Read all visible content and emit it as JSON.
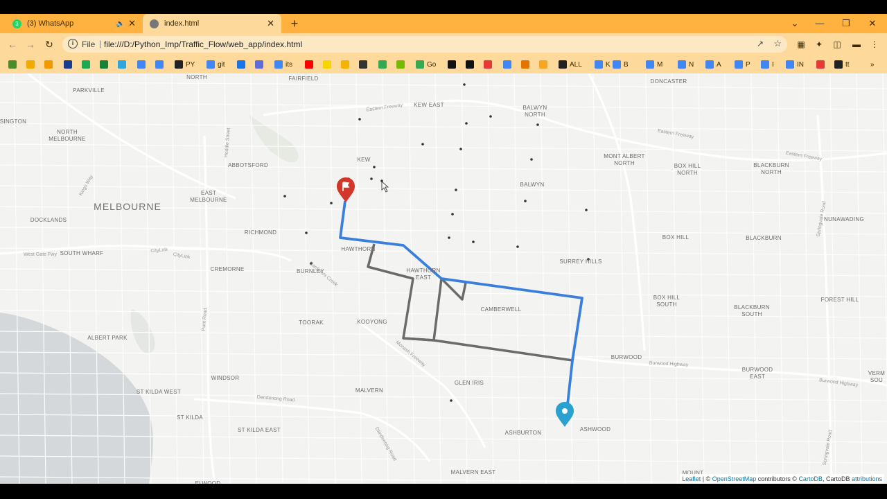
{
  "tabs": [
    {
      "title": "(3) WhatsApp",
      "badge": "3",
      "active": false
    },
    {
      "title": "index.html",
      "active": true
    }
  ],
  "omnibox": {
    "scheme": "File",
    "url": "file:///D:/Python_Imp/Traffic_Flow/web_app/index.html"
  },
  "bookmarks": [
    {
      "label": "",
      "color": "#4b8b2b"
    },
    {
      "label": "",
      "color": "#f2a900"
    },
    {
      "label": "",
      "color": "#f29900"
    },
    {
      "label": "",
      "color": "#1a3e8c"
    },
    {
      "label": "",
      "color": "#1da851"
    },
    {
      "label": "",
      "color": "#188038"
    },
    {
      "label": "",
      "color": "#2ca5e0"
    },
    {
      "label": "",
      "color": "#4285f4"
    },
    {
      "label": "",
      "color": "#4285f4"
    },
    {
      "label": "PY",
      "color": "#222222"
    },
    {
      "label": "git",
      "color": "#4285f4"
    },
    {
      "label": "",
      "color": "#1a73e8"
    },
    {
      "label": "",
      "color": "#5f6bd6"
    },
    {
      "label": "its",
      "color": "#4285f4"
    },
    {
      "label": "",
      "color": "#ff0000"
    },
    {
      "label": "",
      "color": "#f7d600"
    },
    {
      "label": "",
      "color": "#f5b301"
    },
    {
      "label": "",
      "color": "#333333"
    },
    {
      "label": "",
      "color": "#34a853"
    },
    {
      "label": "",
      "color": "#76b900"
    },
    {
      "label": "Go",
      "color": "#34a853"
    },
    {
      "label": "",
      "color": "#111111"
    },
    {
      "label": "",
      "color": "#111111"
    },
    {
      "label": "",
      "color": "#e53935"
    },
    {
      "label": "",
      "color": "#4285f4"
    },
    {
      "label": "",
      "color": "#e37400"
    },
    {
      "label": "",
      "color": "#f5a623"
    },
    {
      "label": "ALL",
      "color": "#222222"
    },
    {
      "label": "K",
      "color": "#4285f4"
    },
    {
      "label": "B",
      "color": "#4285f4"
    },
    {
      "label": "M",
      "color": "#4285f4"
    },
    {
      "label": "N",
      "color": "#4285f4"
    },
    {
      "label": "A",
      "color": "#4285f4"
    },
    {
      "label": "P",
      "color": "#4285f4"
    },
    {
      "label": "I",
      "color": "#4285f4"
    },
    {
      "label": "IN",
      "color": "#4285f4"
    },
    {
      "label": "",
      "color": "#e53935"
    },
    {
      "label": "tt",
      "color": "#222222"
    }
  ],
  "map": {
    "places": [
      {
        "name": "PARKVILLE"
      },
      {
        "name": "NORTH\nMELBOURNE"
      },
      {
        "name": "SINGTON"
      },
      {
        "name": "ABBOTSFORD"
      },
      {
        "name": "EAST\nMELBOURNE"
      },
      {
        "name": "MELBOURNE"
      },
      {
        "name": "DOCKLANDS"
      },
      {
        "name": "RICHMOND"
      },
      {
        "name": "SOUTH WHARF"
      },
      {
        "name": "CREMORNE"
      },
      {
        "name": "BURNLEY"
      },
      {
        "name": "HAWTHORN"
      },
      {
        "name": "HAWTHORN\nEAST"
      },
      {
        "name": "TOORAK"
      },
      {
        "name": "KOOYONG"
      },
      {
        "name": "ALBERT PARK"
      },
      {
        "name": "WINDSOR"
      },
      {
        "name": "ST KILDA WEST"
      },
      {
        "name": "ST KILDA"
      },
      {
        "name": "ST KILDA EAST"
      },
      {
        "name": "ELWOOD"
      },
      {
        "name": "MALVERN"
      },
      {
        "name": "MALVERN EAST"
      },
      {
        "name": "GLEN IRIS"
      },
      {
        "name": "ASHBURTON"
      },
      {
        "name": "ASHWOOD"
      },
      {
        "name": "CAMBERWELL"
      },
      {
        "name": "KEW"
      },
      {
        "name": "KEW EAST"
      },
      {
        "name": "FAIRFIELD"
      },
      {
        "name": "NORTH"
      },
      {
        "name": "BALWYN\nNORTH"
      },
      {
        "name": "BALWYN"
      },
      {
        "name": "MONT ALBERT\nNORTH"
      },
      {
        "name": "DONCASTER"
      },
      {
        "name": "BOX HILL\nNORTH"
      },
      {
        "name": "BLACKBURN\nNORTH"
      },
      {
        "name": "NUNAWADING"
      },
      {
        "name": "BOX HILL"
      },
      {
        "name": "BLACKBURN"
      },
      {
        "name": "SURREY HILLS"
      },
      {
        "name": "BOX HILL\nSOUTH"
      },
      {
        "name": "BLACKBURN\nSOUTH"
      },
      {
        "name": "FOREST HILL"
      },
      {
        "name": "BURWOOD"
      },
      {
        "name": "BURWOOD\nEAST"
      },
      {
        "name": "VERM\nSOU"
      },
      {
        "name": "MOUNT\nWAVE"
      }
    ],
    "road_labels": [
      "Eastern Freeway",
      "Eastern Freeway",
      "Eastern Freeway",
      "Burwood Highway",
      "Burwood Highway",
      "Dandenong Road",
      "Dandenong Road",
      "Monash Freeway",
      "CityLink",
      "CityLink",
      "West Gate Fwy",
      "Springvale Road",
      "Springvale Road",
      "Hoddle Street",
      "Punt Road",
      "Kings Way",
      "Gardiners Creek"
    ],
    "route_colors": {
      "best": "#3a7fdd",
      "alternate": "#6b6b6b"
    },
    "start_marker_color": "#d2372a",
    "end_marker_color": "#2aa1cf"
  },
  "attribution": {
    "leaflet": "Leaflet",
    "sep1": " | © ",
    "osm": "OpenStreetMap",
    "contrib": " contributors © ",
    "carto": "CartoDB",
    "carto2": ", CartoDB ",
    "attrib": "attributions"
  }
}
